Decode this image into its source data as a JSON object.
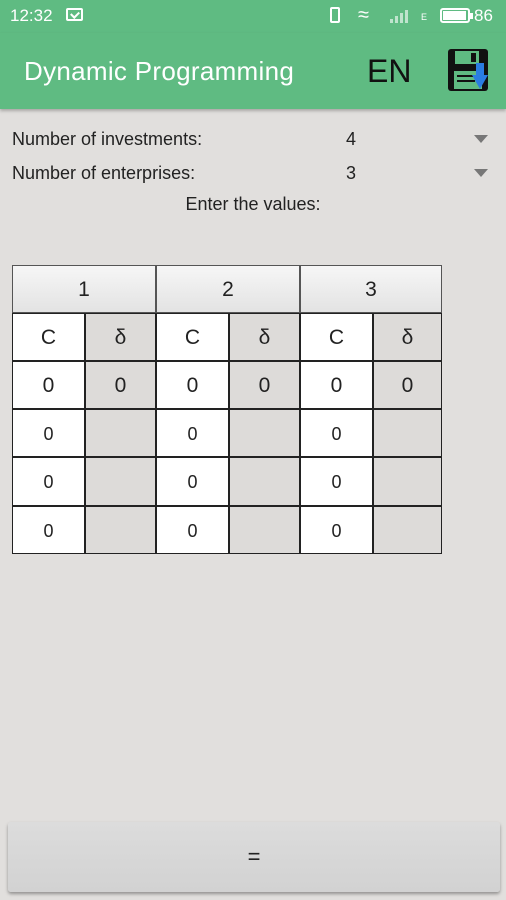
{
  "status_bar": {
    "time": "12:32",
    "battery": "86",
    "network_type": "E"
  },
  "app_bar": {
    "title": "Dynamic Programming",
    "language": "EN",
    "save_icon": "floppy-disk-download-icon"
  },
  "form": {
    "investments": {
      "label": "Number of investments:",
      "value": "4"
    },
    "enterprises": {
      "label": "Number of enterprises:",
      "value": "3"
    },
    "hint": "Enter the values:"
  },
  "table": {
    "enterprise_headers": [
      "1",
      "2",
      "3"
    ],
    "sub_headers": [
      [
        "C",
        "δ"
      ],
      [
        "C",
        "δ"
      ],
      [
        "C",
        "δ"
      ]
    ],
    "rows": [
      [
        "0",
        "0",
        "0",
        "0",
        "0",
        "0"
      ],
      [
        "0",
        "",
        "0",
        "",
        "0",
        ""
      ],
      [
        "0",
        "",
        "0",
        "",
        "0",
        ""
      ],
      [
        "0",
        "",
        "0",
        "",
        "0",
        ""
      ]
    ]
  },
  "calculate_button": {
    "label": "="
  },
  "colors": {
    "primary": "#5fbb82",
    "background": "#e1dfdd",
    "save_accent": "#2a7de1"
  }
}
